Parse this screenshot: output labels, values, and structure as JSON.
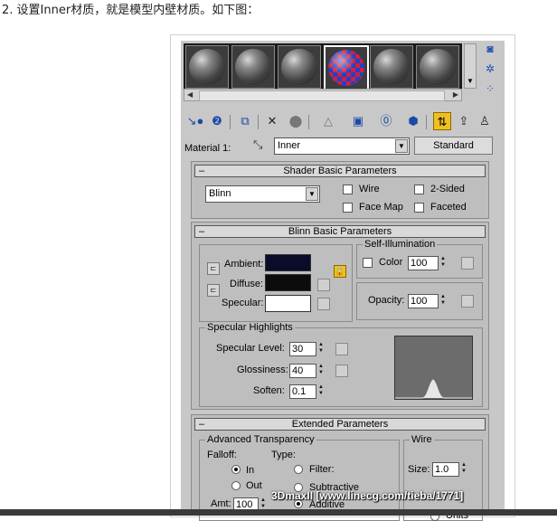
{
  "caption": "2. 设置Inner材质，就是模型内壁材质。如下图：",
  "editor": {
    "material_label": "Material 1:",
    "material_name": "Inner",
    "type_button": "Standard",
    "slots": [
      "grey",
      "grey",
      "grey",
      "checker",
      "grey",
      "grey"
    ],
    "selected_slot": 3
  },
  "toolbar_icons": [
    "get-material-icon",
    "put-to-scene-icon",
    "assign-to-selection-icon",
    "reset-icon",
    "make-unique-icon",
    "put-to-library-icon",
    "material-id-icon",
    "show-map-icon",
    "show-end-result-icon",
    "go-to-parent-icon",
    "go-forward-icon"
  ],
  "shader": {
    "title": "Shader Basic Parameters",
    "shader_type": "Blinn",
    "wire": "Wire",
    "two_sided": "2-Sided",
    "face_map": "Face Map",
    "faceted": "Faceted"
  },
  "blinn": {
    "title": "Blinn Basic Parameters",
    "ambient": "Ambient:",
    "diffuse": "Diffuse:",
    "specular": "Specular:",
    "ambient_color": "#0b0b2a",
    "diffuse_color": "#0c0c0c",
    "specular_color": "#ffffff",
    "self_illum": {
      "group": "Self-Illumination",
      "color_label": "Color",
      "value": "100"
    },
    "opacity": {
      "label": "Opacity:",
      "value": "100"
    },
    "highlights": {
      "group": "Specular Highlights",
      "level_label": "Specular Level:",
      "level": "30",
      "gloss_label": "Glossiness:",
      "gloss": "40",
      "soften_label": "Soften:",
      "soften": "0.1"
    }
  },
  "extended": {
    "title": "Extended Parameters",
    "adv_group": "Advanced Transparency",
    "falloff": "Falloff:",
    "type": "Type:",
    "in": "In",
    "out": "Out",
    "filter": "Filter:",
    "subtractive": "Subtractive",
    "additive": "Additive",
    "amt_label": "Amt:",
    "amt": "100",
    "wire_group": "Wire",
    "size_label": "Size:",
    "size": "1.0",
    "units": "Units"
  },
  "watermark": "3DmaxII  [www.linecg.com/tieba/1771]"
}
